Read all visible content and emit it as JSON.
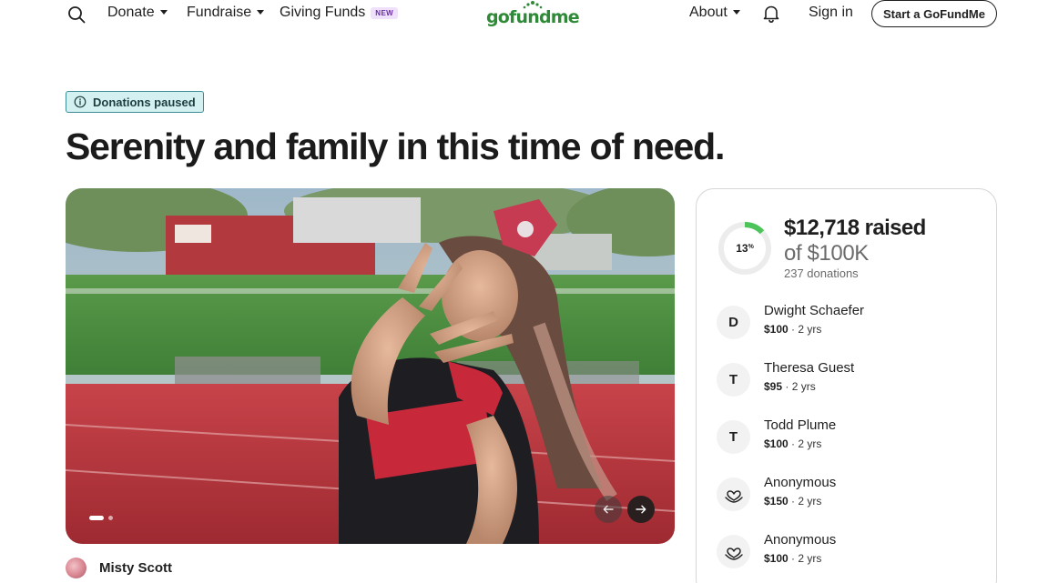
{
  "header": {
    "search_icon": "search-icon",
    "nav": [
      {
        "label": "Donate"
      },
      {
        "label": "Fundraise"
      },
      {
        "label": "Giving Funds",
        "badge": "NEW"
      }
    ],
    "logo_text": "gofundme",
    "about_label": "About",
    "bell_icon": "bell-icon",
    "sign_in_label": "Sign in",
    "start_button_label": "Start a GoFundMe"
  },
  "status_badge": "Donations paused",
  "title": "Serenity and family in this time of need.",
  "gallery": {
    "total_slides": 2,
    "active_slide": 1
  },
  "organizer": {
    "name": "Misty Scott"
  },
  "summary": {
    "progress_percent": 13,
    "percent_label": "13",
    "percent_sign": "%",
    "raised": "$12,718 raised",
    "goal": "of $100K",
    "donations": "237 donations"
  },
  "donors": [
    {
      "initial": "D",
      "name": "Dwight Schaefer",
      "amount": "$100",
      "time": " · 2 yrs"
    },
    {
      "initial": "T",
      "name": "Theresa Guest",
      "amount": "$95",
      "time": " · 2 yrs"
    },
    {
      "initial": "T",
      "name": "Todd Plume",
      "amount": "$100",
      "time": " · 2 yrs"
    },
    {
      "initial": "",
      "name": "Anonymous",
      "amount": "$150",
      "time": " · 2 yrs",
      "icon": "heart-hand-icon"
    },
    {
      "initial": "",
      "name": "Anonymous",
      "amount": "$100",
      "time": " · 2 yrs",
      "icon": "heart-hand-icon"
    }
  ],
  "colors": {
    "brand_green": "#2f8a37",
    "progress_green": "#4cc45a",
    "badge_bg": "#d4f0f1",
    "badge_border": "#3b8d93"
  }
}
